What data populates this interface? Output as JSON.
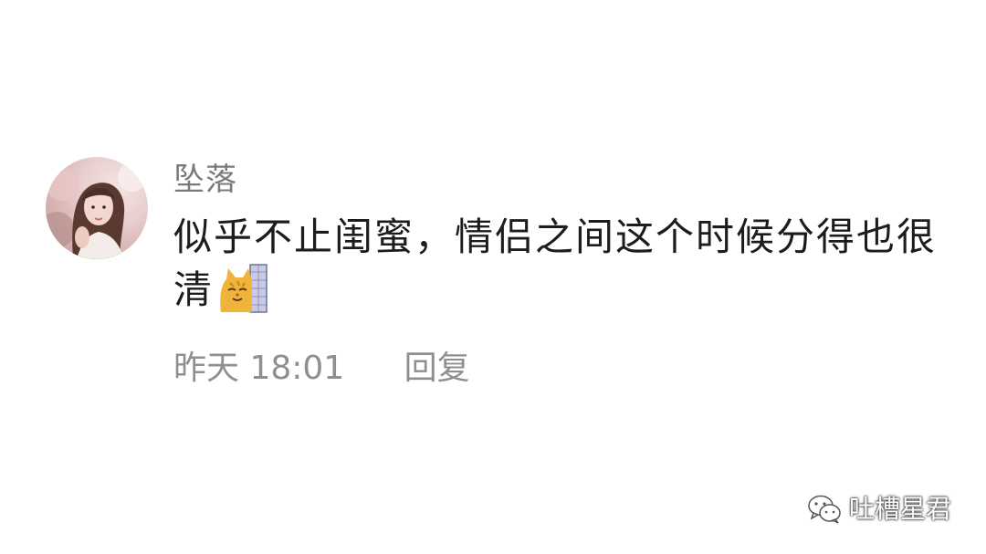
{
  "comment": {
    "username": "坠落",
    "text": "似乎不止闺蜜，情侣之间这个时候分得也很清",
    "emoji": "cat-peeking-emoji",
    "time": "昨天 18:01",
    "reply_label": "回复"
  },
  "watermark": {
    "text": "吐槽星君",
    "icon": "wechat-icon"
  }
}
